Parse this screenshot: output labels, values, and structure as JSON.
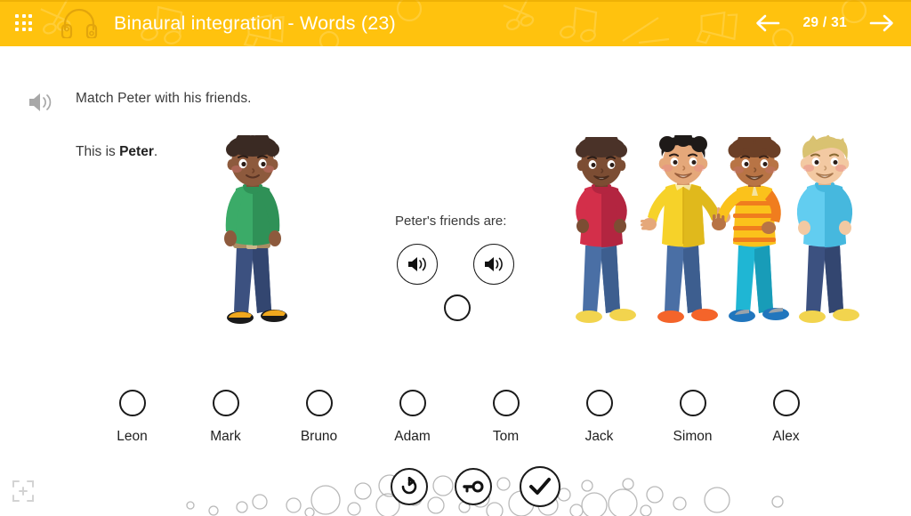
{
  "header": {
    "grid_icon": "grid-apps-icon",
    "headphones_icon": "headphones-icon",
    "title": "Binaural integration - Words (23)",
    "prev_icon": "arrow-left-icon",
    "next_icon": "arrow-right-icon",
    "page_counter": "29 / 31",
    "background_color": "#ffc20e",
    "title_color": "#ffffff",
    "pattern_motifs": [
      "scissors",
      "music-note",
      "megaphone"
    ]
  },
  "exercise": {
    "audio_icon": "speaker-icon",
    "instruction": "Match Peter with his friends.",
    "subject_prefix": "This is ",
    "subject_name": "Peter",
    "subject_suffix": ".",
    "center_prompt": "Peter's friends are:",
    "sound_buttons": [
      {
        "name": "sound-button-1",
        "icon": "speaker-icon"
      },
      {
        "name": "sound-button-2",
        "icon": "speaker-icon"
      }
    ],
    "center_drop_target": "answer-drop-circle"
  },
  "characters": {
    "subject": {
      "name": "Peter",
      "hair": "#3a2a23",
      "skin": "#8d5a3d",
      "shirt": "#3bab68",
      "shirt_shade": "#2f9157",
      "pants": "#3c5180",
      "pants_shade": "#334670",
      "belt": "#a98d63",
      "shoe_a": "#f0a81e",
      "shoe_b": "#1a1a1a"
    },
    "friends": [
      {
        "index": 1,
        "hair": "#4a3228",
        "skin": "#7c4d33",
        "shirt": "#d32f4a",
        "shirt_shade": "#b32540",
        "pants": "#4a6fa5",
        "pants_shade": "#3d5e8f",
        "shoes": "#f2d44e"
      },
      {
        "index": 2,
        "hair": "#1e1a18",
        "skin": "#e5a87a",
        "shirt": "#f6d229",
        "shirt_shade": "#e0b91c",
        "pants": "#4a6fa5",
        "pants_shade": "#3d5e8f",
        "shoes": "#f4642a"
      },
      {
        "index": 3,
        "hair": "#6b3f26",
        "skin": "#b87445",
        "shirt": "#fbc21b",
        "shirt_shade": "#f07d1e",
        "pants": "#1fb6d4",
        "pants_shade": "#189cb8",
        "shoes": "#2176bd"
      },
      {
        "index": 4,
        "hair": "#d9c271",
        "skin": "#f3c9a2",
        "shirt": "#62cdf0",
        "shirt_shade": "#46b8de",
        "pants": "#3c5180",
        "pants_shade": "#334670",
        "shoes": "#f2d44e"
      }
    ]
  },
  "answers": {
    "options": [
      {
        "label": "Leon"
      },
      {
        "label": "Mark"
      },
      {
        "label": "Bruno"
      },
      {
        "label": "Adam"
      },
      {
        "label": "Tom"
      },
      {
        "label": "Jack"
      },
      {
        "label": "Simon"
      },
      {
        "label": "Alex"
      }
    ]
  },
  "toolbar": {
    "replay_icon": "replay-icon",
    "key_icon": "key-icon",
    "check_icon": "check-icon",
    "fullscreen_icon": "fullscreen-expand-icon",
    "bubble_decoration": "bubbles"
  }
}
